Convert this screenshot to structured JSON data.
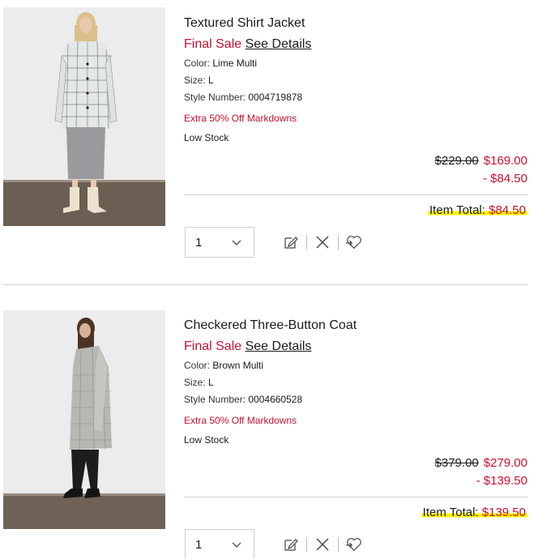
{
  "items": [
    {
      "title": "Textured Shirt Jacket",
      "final_sale": "Final Sale",
      "see_details": "See Details",
      "color_label": "Color:",
      "color_value": "Lime Multi",
      "size_label": "Size:",
      "size_value": "L",
      "style_label": "Style Number:",
      "style_value": "0004719878",
      "promo": "Extra 50% Off Markdowns",
      "stock": "Low Stock",
      "original_price": "$229.00",
      "sale_price": "$169.00",
      "discount": "- $84.50",
      "total_label": "Item Total:",
      "total_amount": "$84.50",
      "quantity": "1"
    },
    {
      "title": "Checkered Three-Button Coat",
      "final_sale": "Final Sale",
      "see_details": "See Details",
      "color_label": "Color:",
      "color_value": "Brown Multi",
      "size_label": "Size:",
      "size_value": "L",
      "style_label": "Style Number:",
      "style_value": "0004660528",
      "promo": "Extra 50% Off Markdowns",
      "stock": "Low Stock",
      "original_price": "$379.00",
      "sale_price": "$279.00",
      "discount": "- $139.50",
      "total_label": "Item Total:",
      "total_amount": "$139.50",
      "quantity": "1"
    }
  ],
  "icons": {
    "edit": "edit-icon",
    "remove": "close-icon",
    "wishlist": "heart-move-icon",
    "chevron": "chevron-down-icon"
  }
}
